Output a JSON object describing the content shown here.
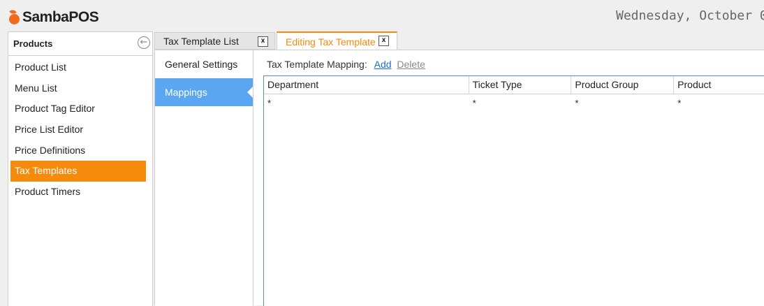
{
  "app": {
    "logo_text": "SambaPOS",
    "clock_text": "Wednesday, October 0"
  },
  "sidebar": {
    "title": "Products",
    "items": [
      {
        "label": "Product List"
      },
      {
        "label": "Menu List"
      },
      {
        "label": "Product Tag Editor"
      },
      {
        "label": "Price List Editor"
      },
      {
        "label": "Price Definitions"
      },
      {
        "label": "Tax Templates",
        "active": true
      },
      {
        "label": "Product Timers"
      }
    ]
  },
  "tabs": [
    {
      "label": "Tax Template List",
      "close": "x",
      "active": false
    },
    {
      "label": "Editing Tax Template",
      "close": "x",
      "active": true
    }
  ],
  "editor": {
    "subnav": [
      {
        "label": "General Settings"
      },
      {
        "label": "Mappings",
        "active": true
      }
    ],
    "mapping_label": "Tax Template Mapping:",
    "add_label": "Add",
    "delete_label": "Delete",
    "grid": {
      "columns": [
        "Department",
        "Ticket Type",
        "Product Group",
        "Product"
      ],
      "rows": [
        [
          "*",
          "*",
          "*",
          "*"
        ]
      ]
    }
  },
  "colors": {
    "accent_orange": "#f58a0c",
    "selected_blue": "#5aa6f0",
    "link_blue": "#1a6fc9"
  }
}
